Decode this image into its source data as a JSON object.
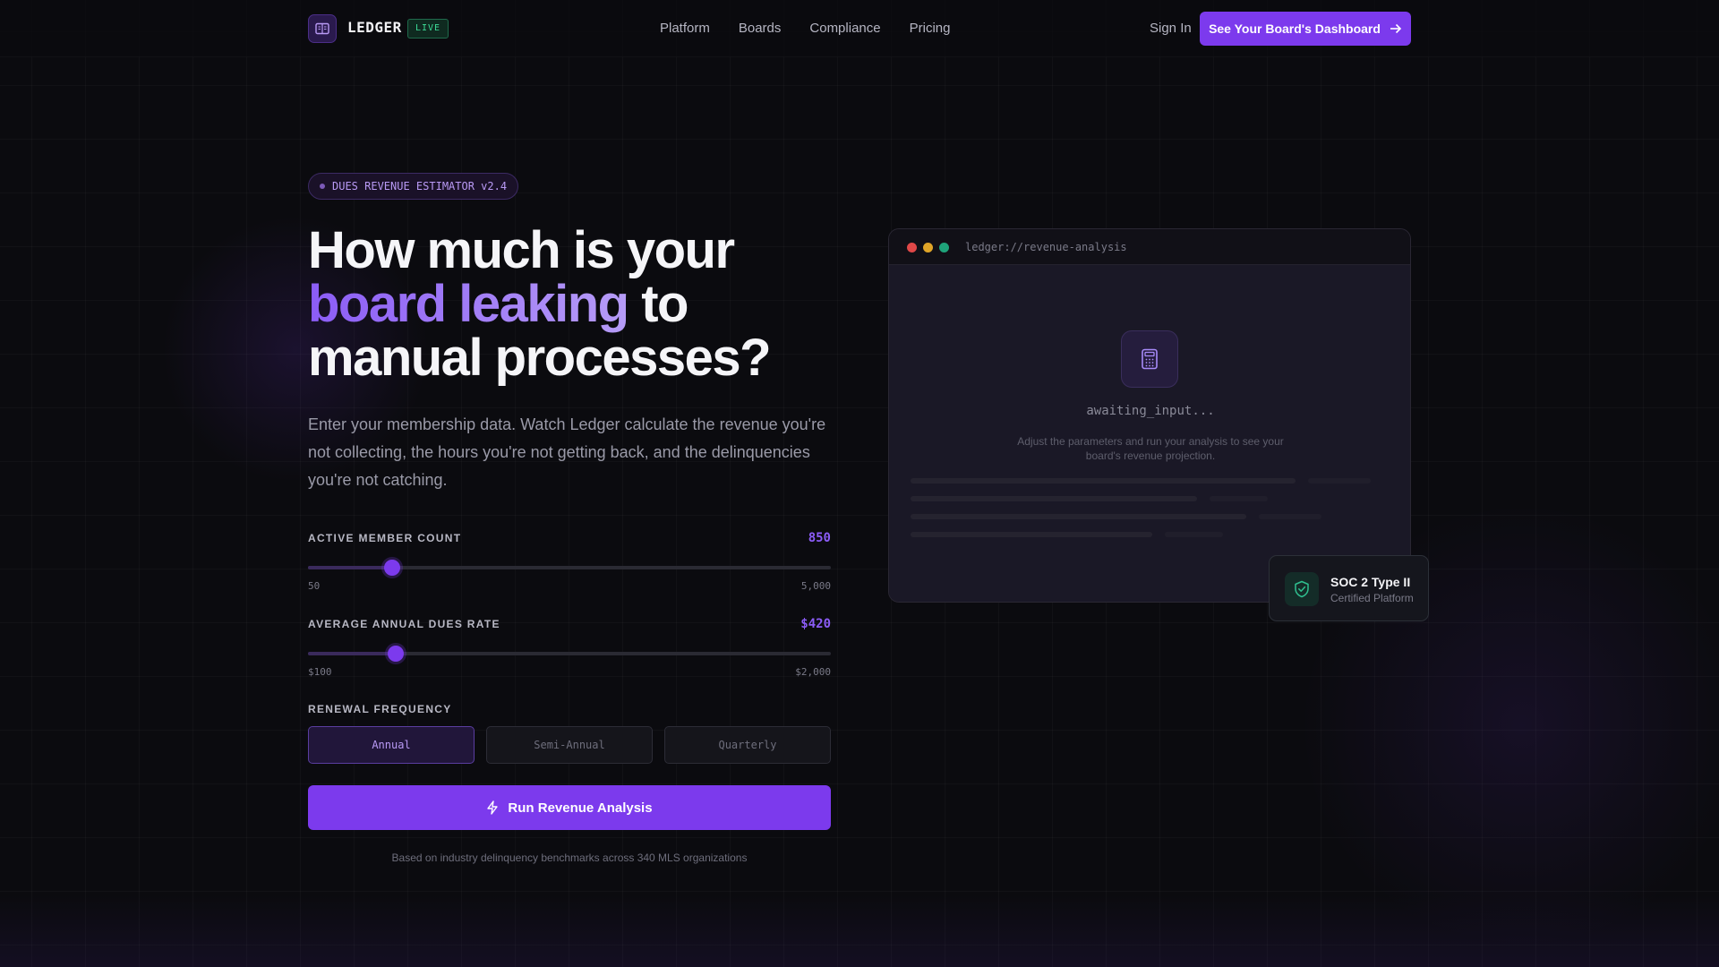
{
  "nav": {
    "brand": "LEDGER",
    "live_badge": "LIVE",
    "links": [
      "Platform",
      "Boards",
      "Compliance",
      "Pricing"
    ],
    "sign_in": "Sign In",
    "cta": "See Your Board's Dashboard"
  },
  "hero": {
    "pill": "DUES REVENUE ESTIMATOR v2.4",
    "headline_1": "How much is your",
    "headline_accent": "board leaking",
    "headline_2": " to",
    "headline_3": "manual processes?",
    "subcopy": "Enter your membership data. Watch Ledger calculate the revenue you're not collecting, the hours you're not getting back, and the delinquencies you're not catching."
  },
  "calculator": {
    "member_count": {
      "label": "ACTIVE MEMBER COUNT",
      "value_text": "850",
      "value": 850,
      "min_label": "50",
      "max_label": "5,000",
      "min": 50,
      "max": 5000
    },
    "dues_rate": {
      "label": "AVERAGE ANNUAL DUES RATE",
      "value_text": "$420",
      "value": 420,
      "min_label": "$100",
      "max_label": "$2,000",
      "min": 100,
      "max": 2000
    },
    "frequency": {
      "label": "RENEWAL FREQUENCY",
      "options": [
        "Annual",
        "Semi-Annual",
        "Quarterly"
      ],
      "selected": "Annual"
    },
    "run_button": "Run Revenue Analysis",
    "footnote": "Based on industry delinquency benchmarks across 340 MLS organizations"
  },
  "panel": {
    "url": "ledger://revenue-analysis",
    "status": "awaiting_input...",
    "hint": "Adjust the parameters and run your analysis to see your board's revenue projection."
  },
  "soc_badge": {
    "title": "SOC 2 Type II",
    "subtitle": "Certified Platform"
  },
  "colors": {
    "accent": "#7c3aed",
    "accent_light": "#8b5cf6",
    "live_green": "#3ddc97",
    "background": "#0b0b0f",
    "dot_red": "#e04848",
    "dot_yellow": "#e0a528",
    "dot_green": "#1fa37a"
  },
  "icons": {
    "logo": "ledger-book-icon",
    "cta_arrow": "arrow-right-icon",
    "run": "lightning-icon",
    "panel": "calculator-icon",
    "soc": "shield-check-icon"
  }
}
